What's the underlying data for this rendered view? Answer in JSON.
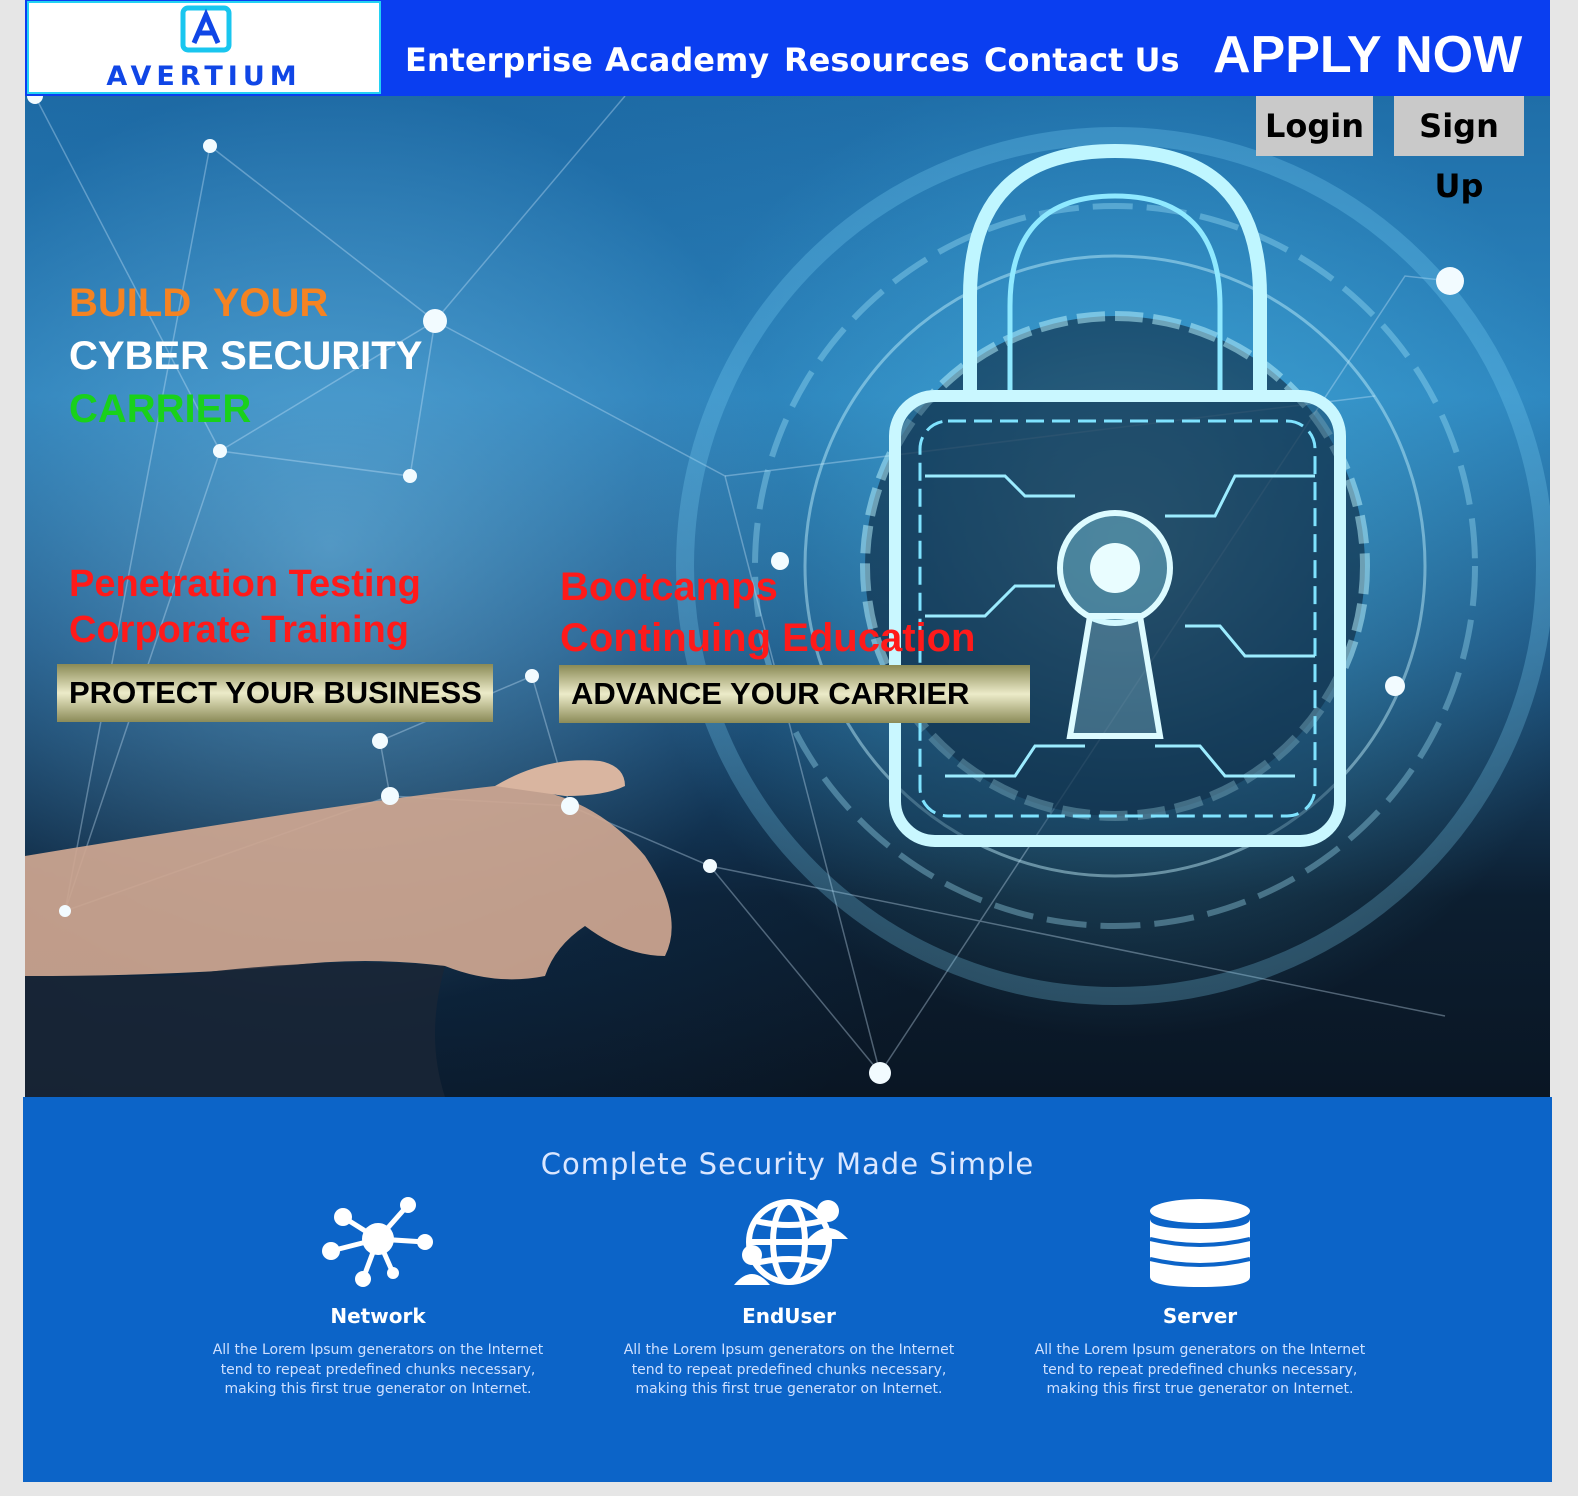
{
  "header": {
    "logo_text": "AVERTIUM",
    "nav": [
      "Enterprise",
      "Academy",
      "Resources",
      "Contact Us"
    ],
    "apply_label": "APPLY NOW"
  },
  "auth": {
    "login_label": "Login",
    "signup_label": "Sign Up"
  },
  "hero": {
    "headline": [
      "BUILD  YOUR",
      "CYBER SECURITY",
      "CARRIER"
    ],
    "headline_colors": [
      "#f58322",
      "#ffffff",
      "#19d11b"
    ],
    "services_left": [
      "Penetration Testing",
      "Corporate Training"
    ],
    "services_right": [
      "Bootcamps",
      "Continuing Education"
    ],
    "cta_left": "PROTECT YOUR BUSINESS",
    "cta_right": "ADVANCE YOUR CARRIER"
  },
  "features": {
    "title": "Complete Security Made Simple",
    "items": [
      {
        "icon": "network-icon",
        "name": "Network",
        "description": "All the Lorem Ipsum generators on the Internet tend to repeat predefined chunks necessary, making this first true generator on Internet."
      },
      {
        "icon": "globe-users-icon",
        "name": "EndUser",
        "description": "All the Lorem Ipsum generators on the Internet tend to repeat predefined chunks necessary, making this first true generator on Internet."
      },
      {
        "icon": "database-icon",
        "name": "Server",
        "description": "All the Lorem Ipsum generators on the Internet tend to repeat predefined chunks necessary, making this first true generator on Internet."
      }
    ]
  },
  "colors": {
    "header_bg": "#0a3ef0",
    "features_bg": "#0c64c8",
    "service_text": "#ff1a1a",
    "logo_border": "#23d2f3"
  }
}
